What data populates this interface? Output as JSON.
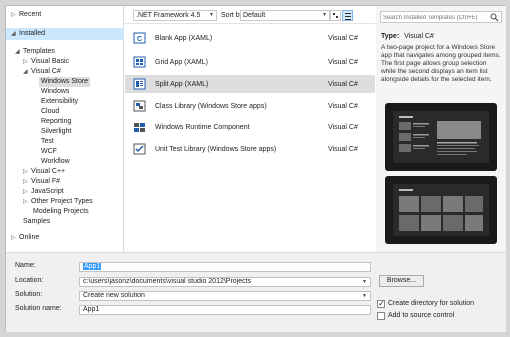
{
  "tree": {
    "recent": "Recent",
    "installed": "Installed",
    "templates": "Templates",
    "visual_basic": "Visual Basic",
    "visual_csharp": "Visual C#",
    "csharp_children": [
      "Windows Store",
      "Windows",
      "Extensibility",
      "Cloud",
      "Reporting",
      "Silverlight",
      "Test",
      "WCF",
      "Workflow"
    ],
    "visual_cpp": "Visual C++",
    "visual_fsharp": "Visual F#",
    "javascript": "JavaScript",
    "other_project_types": "Other Project Types",
    "modeling_projects": "Modeling Projects",
    "samples": "Samples",
    "online": "Online"
  },
  "toolbar": {
    "framework": ".NET Framework 4.5",
    "sort_label": "Sort by:",
    "sort_value": "Default"
  },
  "templates": [
    {
      "name": "Blank App (XAML)",
      "lang": "Visual C#"
    },
    {
      "name": "Grid App (XAML)",
      "lang": "Visual C#"
    },
    {
      "name": "Split App (XAML)",
      "lang": "Visual C#"
    },
    {
      "name": "Class Library (Windows Store apps)",
      "lang": "Visual C#"
    },
    {
      "name": "Windows Runtime Component",
      "lang": "Visual C#"
    },
    {
      "name": "Unit Test Library (Windows Store apps)",
      "lang": "Visual C#"
    }
  ],
  "details": {
    "search_placeholder": "Search Installed Templates (Ctrl+E)",
    "type_label": "Type:",
    "type_value": "Visual C#",
    "description": "A two-page project for a Windows Store app that navigates among grouped items. The first page allows group selection while the second displays an item list alongside details for the selected item."
  },
  "form": {
    "name_label": "Name:",
    "name_value": "App1",
    "location_label": "Location:",
    "location_value": "c:\\users\\jasonz\\documents\\visual studio 2012\\Projects",
    "browse_label": "Browse...",
    "solution_label": "Solution:",
    "solution_value": "Create new solution",
    "solution_name_label": "Solution name:",
    "solution_name_value": "App1",
    "create_dir_label": "Create directory for solution",
    "create_dir_checked": true,
    "source_control_label": "Add to source control",
    "source_control_checked": false
  },
  "colors": {
    "selection": "#dddddd",
    "installed_highlight": "#cce8ff",
    "name_highlight": "#3399ff",
    "icon_blue": "#1f5fae"
  }
}
